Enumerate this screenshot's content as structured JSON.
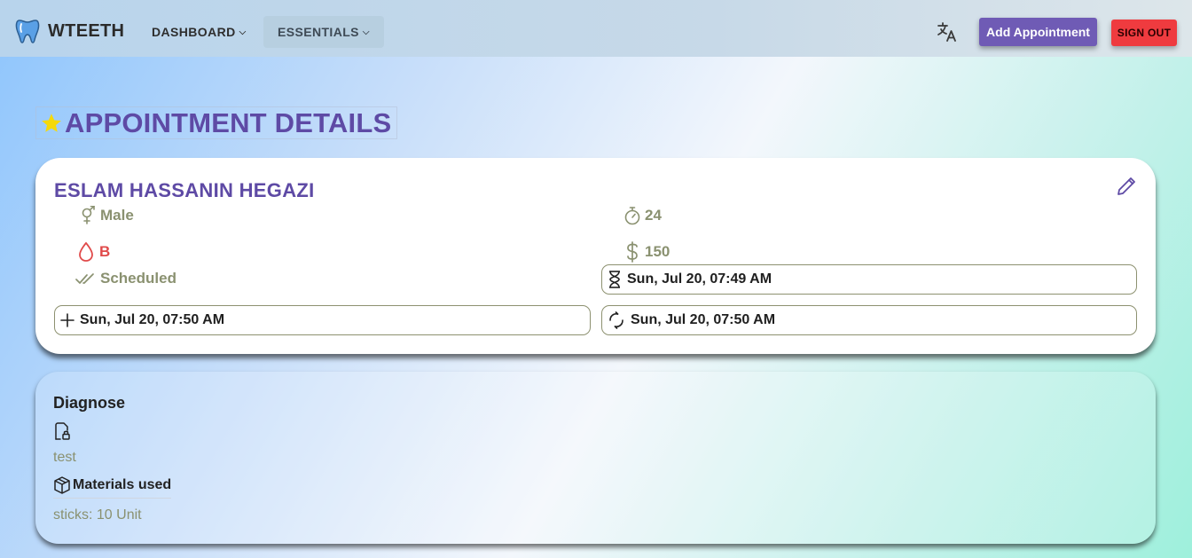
{
  "navbar": {
    "brand": "WTEETH",
    "items": [
      {
        "label": "DASHBOARD",
        "caret": "⌵"
      },
      {
        "label": "ESSENTIALS",
        "caret": "⌵"
      }
    ],
    "translate_icon": "translate-icon",
    "add_button": "Add Appointment",
    "signout_button": "SIGN OUT"
  },
  "page": {
    "title": "APPOINTMENT DETAILS",
    "title_icon": "star-icon"
  },
  "appointment": {
    "patient_name": "ESLAM HASSANIN HEGAZI",
    "gender": "Male",
    "age": "24",
    "blood_type": "B",
    "price": "150",
    "status": "Scheduled",
    "duration_time": "Sun, Jul 20, 07:49 AM",
    "created_time": "Sun, Jul 20, 07:50 AM",
    "updated_time": "Sun, Jul 20, 07:50 AM"
  },
  "details": {
    "diagnose_title": "Diagnose",
    "diagnose_text": "test",
    "materials_title": "Materials used",
    "materials_text": "sticks: 10 Unit"
  },
  "colors": {
    "accent_purple": "#5e4aa5",
    "button_purple": "#6f5bb5",
    "signout_red": "#ef3b3f",
    "muted_olive": "#8a9170",
    "blood_red": "#e04a4a",
    "star_yellow": "#f5d90a"
  }
}
